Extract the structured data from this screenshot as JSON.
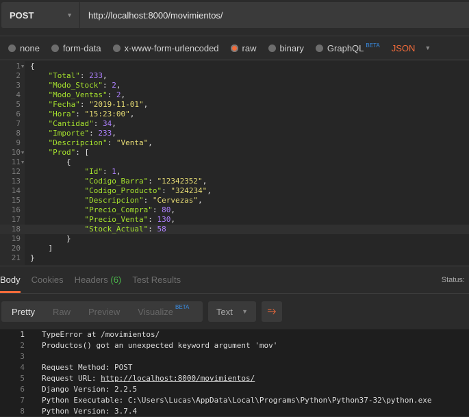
{
  "request": {
    "method": "POST",
    "url": "http://localhost:8000/movimientos/"
  },
  "body_types": [
    {
      "label": "none",
      "selected": false
    },
    {
      "label": "form-data",
      "selected": false
    },
    {
      "label": "x-www-form-urlencoded",
      "selected": false
    },
    {
      "label": "raw",
      "selected": true
    },
    {
      "label": "binary",
      "selected": false
    },
    {
      "label": "GraphQL",
      "selected": false,
      "badge": "BETA"
    }
  ],
  "format": "JSON",
  "editor": {
    "active_line": 18,
    "folds": [
      1,
      10,
      11
    ],
    "lines": [
      [
        {
          "t": "{",
          "c": "p"
        }
      ],
      [
        {
          "t": "    ",
          "c": "p"
        },
        {
          "t": "\"Total\"",
          "c": "k"
        },
        {
          "t": ": ",
          "c": "p"
        },
        {
          "t": "233",
          "c": "n"
        },
        {
          "t": ",",
          "c": "p"
        }
      ],
      [
        {
          "t": "    ",
          "c": "p"
        },
        {
          "t": "\"Modo_Stock\"",
          "c": "k"
        },
        {
          "t": ": ",
          "c": "p"
        },
        {
          "t": "2",
          "c": "n"
        },
        {
          "t": ",",
          "c": "p"
        }
      ],
      [
        {
          "t": "    ",
          "c": "p"
        },
        {
          "t": "\"Modo_Ventas\"",
          "c": "k"
        },
        {
          "t": ": ",
          "c": "p"
        },
        {
          "t": "2",
          "c": "n"
        },
        {
          "t": ",",
          "c": "p"
        }
      ],
      [
        {
          "t": "    ",
          "c": "p"
        },
        {
          "t": "\"Fecha\"",
          "c": "k"
        },
        {
          "t": ": ",
          "c": "p"
        },
        {
          "t": "\"2019-11-01\"",
          "c": "s"
        },
        {
          "t": ",",
          "c": "p"
        }
      ],
      [
        {
          "t": "    ",
          "c": "p"
        },
        {
          "t": "\"Hora\"",
          "c": "k"
        },
        {
          "t": ": ",
          "c": "p"
        },
        {
          "t": "\"15:23:00\"",
          "c": "s"
        },
        {
          "t": ",",
          "c": "p"
        }
      ],
      [
        {
          "t": "    ",
          "c": "p"
        },
        {
          "t": "\"Cantidad\"",
          "c": "k"
        },
        {
          "t": ": ",
          "c": "p"
        },
        {
          "t": "34",
          "c": "n"
        },
        {
          "t": ",",
          "c": "p"
        }
      ],
      [
        {
          "t": "    ",
          "c": "p"
        },
        {
          "t": "\"Importe\"",
          "c": "k"
        },
        {
          "t": ": ",
          "c": "p"
        },
        {
          "t": "233",
          "c": "n"
        },
        {
          "t": ",",
          "c": "p"
        }
      ],
      [
        {
          "t": "    ",
          "c": "p"
        },
        {
          "t": "\"Descripcion\"",
          "c": "k"
        },
        {
          "t": ": ",
          "c": "p"
        },
        {
          "t": "\"Venta\"",
          "c": "s"
        },
        {
          "t": ",",
          "c": "p"
        }
      ],
      [
        {
          "t": "    ",
          "c": "p"
        },
        {
          "t": "\"Prod\"",
          "c": "k"
        },
        {
          "t": ": [",
          "c": "p"
        }
      ],
      [
        {
          "t": "        {",
          "c": "p"
        }
      ],
      [
        {
          "t": "            ",
          "c": "p"
        },
        {
          "t": "\"Id\"",
          "c": "k"
        },
        {
          "t": ": ",
          "c": "p"
        },
        {
          "t": "1",
          "c": "n"
        },
        {
          "t": ",",
          "c": "p"
        }
      ],
      [
        {
          "t": "            ",
          "c": "p"
        },
        {
          "t": "\"Codigo_Barra\"",
          "c": "k"
        },
        {
          "t": ": ",
          "c": "p"
        },
        {
          "t": "\"12342352\"",
          "c": "s"
        },
        {
          "t": ",",
          "c": "p"
        }
      ],
      [
        {
          "t": "            ",
          "c": "p"
        },
        {
          "t": "\"Codigo_Producto\"",
          "c": "k"
        },
        {
          "t": ": ",
          "c": "p"
        },
        {
          "t": "\"324234\"",
          "c": "s"
        },
        {
          "t": ",",
          "c": "p"
        }
      ],
      [
        {
          "t": "            ",
          "c": "p"
        },
        {
          "t": "\"Descripcion\"",
          "c": "k"
        },
        {
          "t": ": ",
          "c": "p"
        },
        {
          "t": "\"Cervezas\"",
          "c": "s"
        },
        {
          "t": ",",
          "c": "p"
        }
      ],
      [
        {
          "t": "            ",
          "c": "p"
        },
        {
          "t": "\"Precio_Compra\"",
          "c": "k"
        },
        {
          "t": ": ",
          "c": "p"
        },
        {
          "t": "80",
          "c": "n"
        },
        {
          "t": ",",
          "c": "p"
        }
      ],
      [
        {
          "t": "            ",
          "c": "p"
        },
        {
          "t": "\"Precio_Venta\"",
          "c": "k"
        },
        {
          "t": ": ",
          "c": "p"
        },
        {
          "t": "130",
          "c": "n"
        },
        {
          "t": ",",
          "c": "p"
        }
      ],
      [
        {
          "t": "            ",
          "c": "p"
        },
        {
          "t": "\"Stock_Actual\"",
          "c": "k"
        },
        {
          "t": ": ",
          "c": "p"
        },
        {
          "t": "58",
          "c": "n"
        }
      ],
      [
        {
          "t": "        }",
          "c": "p"
        }
      ],
      [
        {
          "t": "    ]",
          "c": "p"
        }
      ],
      [
        {
          "t": "}",
          "c": "p"
        }
      ]
    ]
  },
  "response": {
    "tabs": [
      {
        "label": "Body",
        "active": true
      },
      {
        "label": "Cookies"
      },
      {
        "label": "Headers",
        "count": "(6)"
      },
      {
        "label": "Test Results"
      }
    ],
    "status_label": "Status:",
    "views": [
      "Pretty",
      "Raw",
      "Preview",
      "Visualize"
    ],
    "visualize_badge": "BETA",
    "type": "Text",
    "lines": [
      [
        {
          "t": "TypeError at /movimientos/"
        }
      ],
      [
        {
          "t": "Productos() got an unexpected keyword argument 'mov'"
        }
      ],
      [],
      [
        {
          "t": "Request Method: POST"
        }
      ],
      [
        {
          "t": "Request URL: "
        },
        {
          "t": "http://localhost:8000/movimientos/",
          "link": true
        }
      ],
      [
        {
          "t": "Django Version: 2.2.5"
        }
      ],
      [
        {
          "t": "Python Executable: C:\\Users\\Lucas\\AppData\\Local\\Programs\\Python\\Python37-32\\python.exe"
        }
      ],
      [
        {
          "t": "Python Version: 3.7.4"
        }
      ]
    ]
  }
}
